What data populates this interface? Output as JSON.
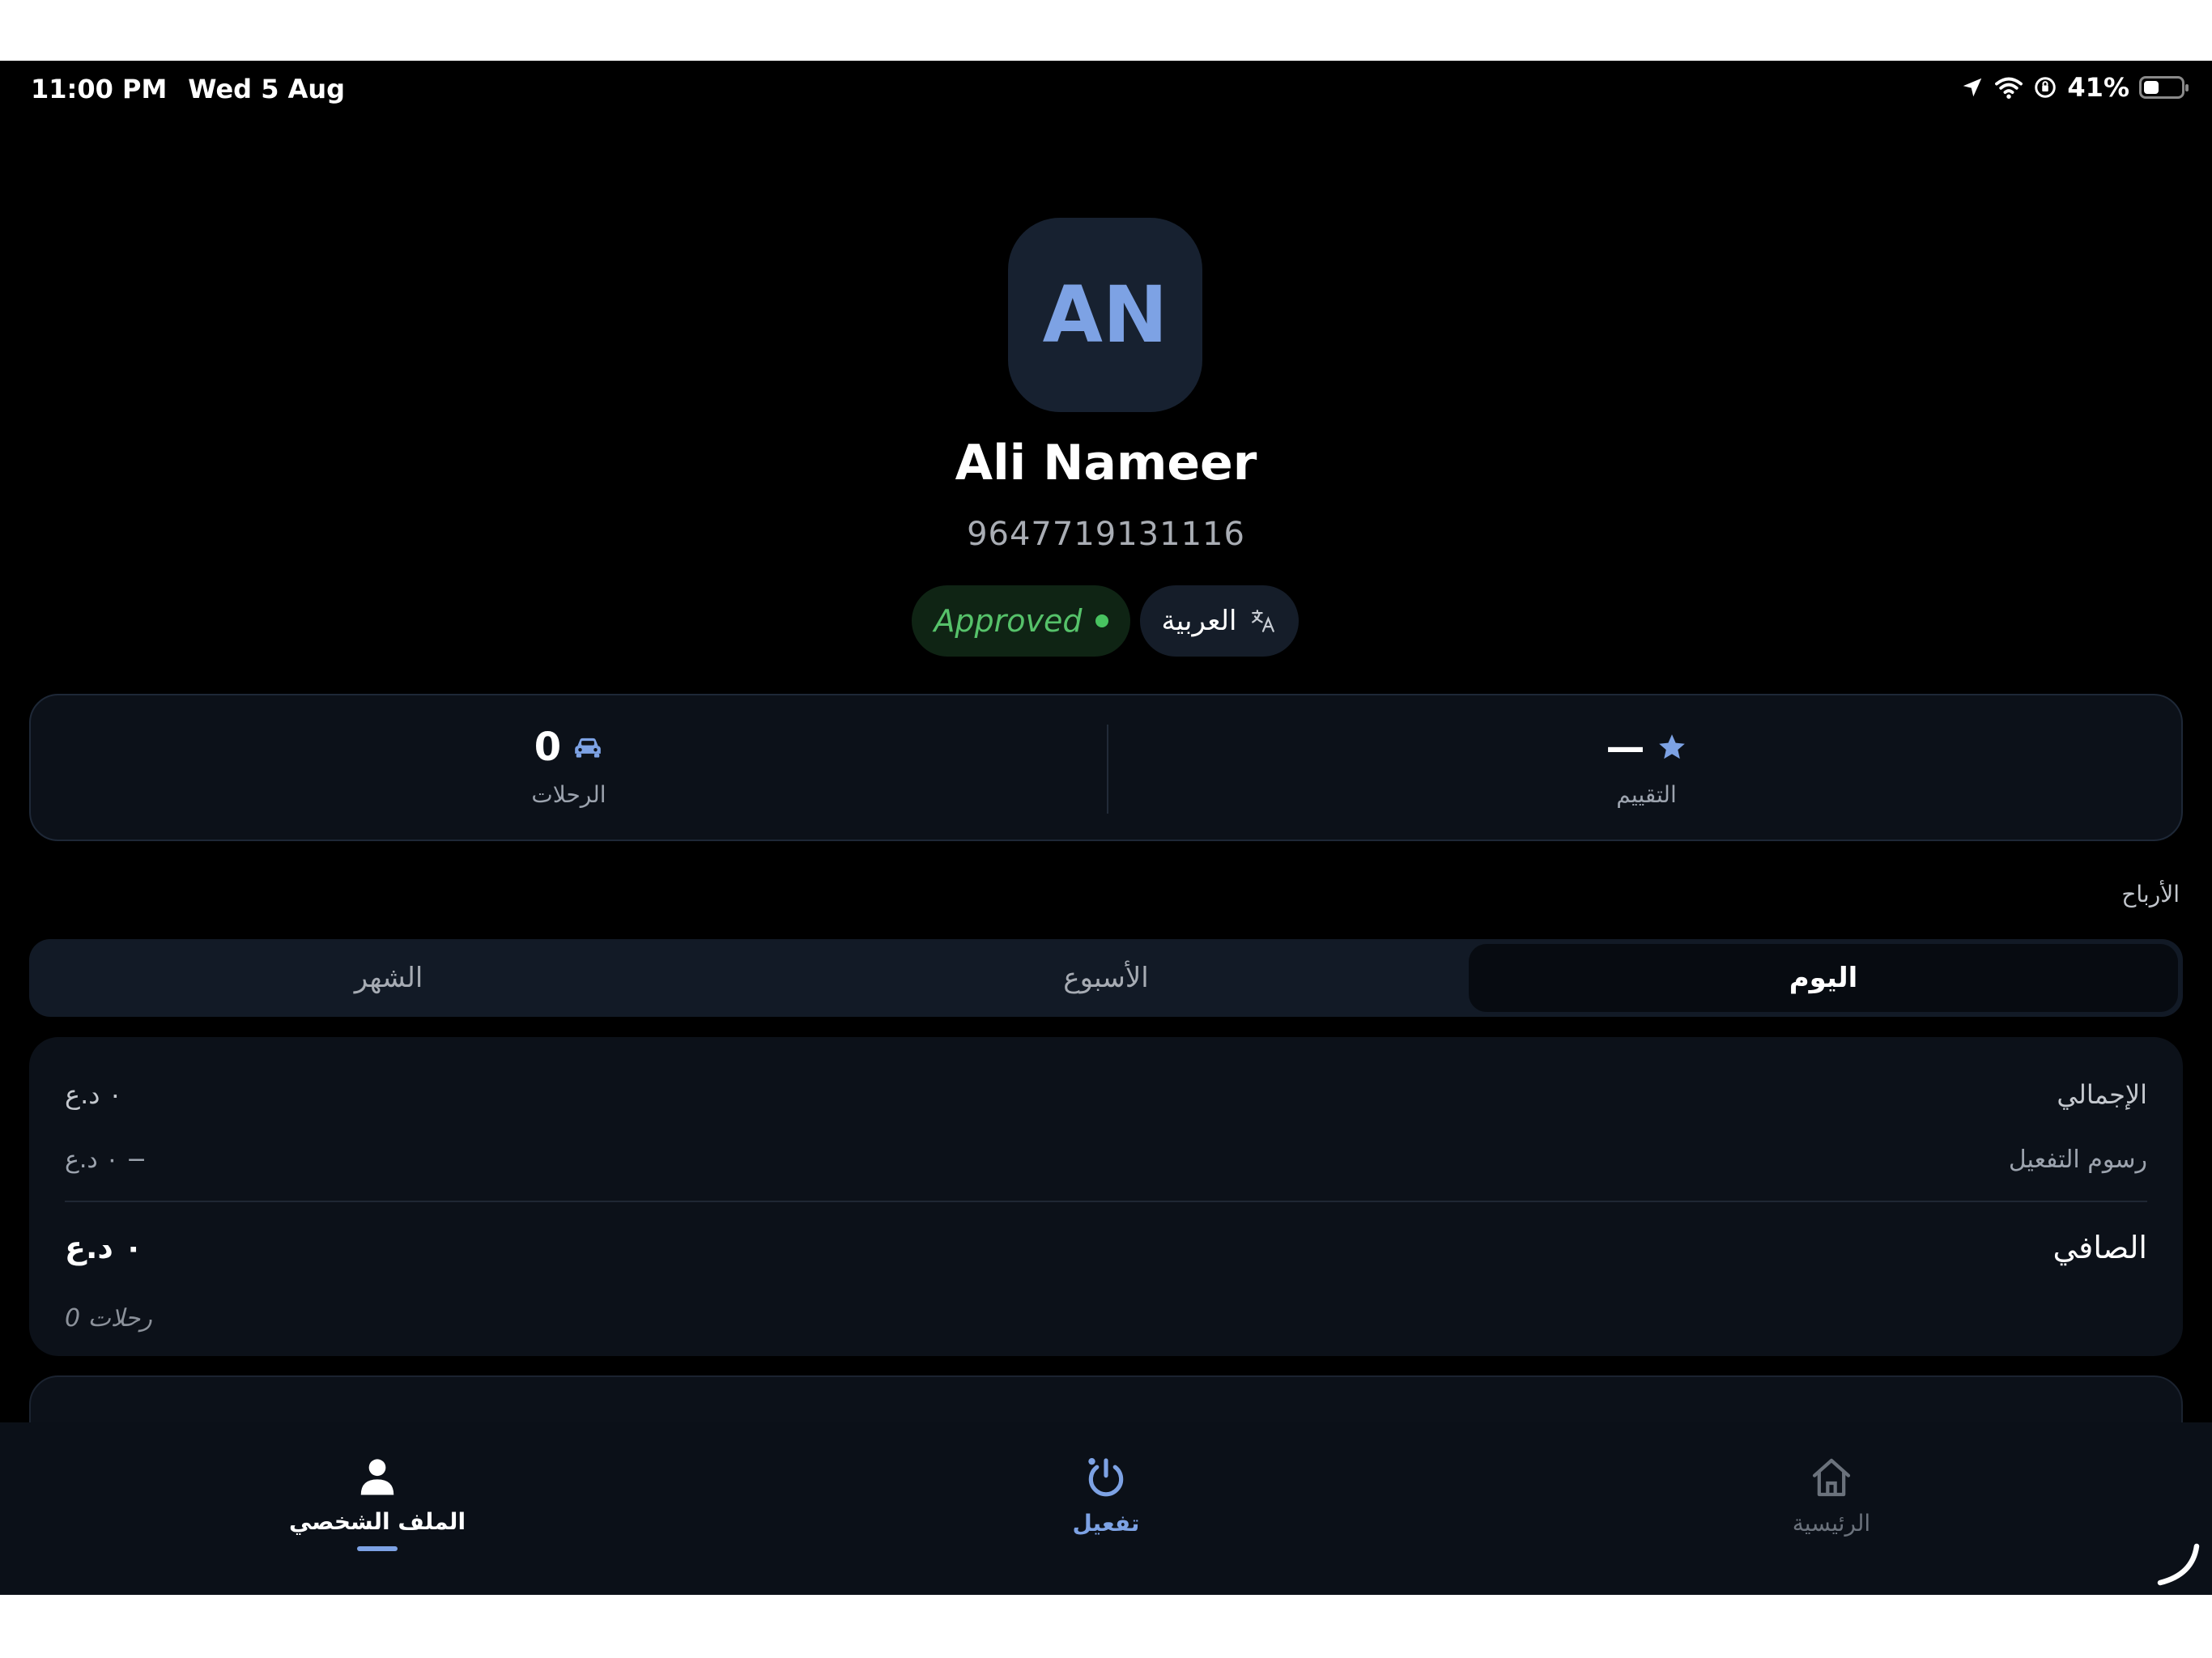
{
  "status_bar": {
    "time": "11:00 PM",
    "date": "Wed 5 Aug",
    "battery_text": "41%",
    "battery_level": 0.41,
    "icons": [
      "location-arrow-icon",
      "wifi-icon",
      "orientation-lock-icon",
      "battery-icon"
    ]
  },
  "profile": {
    "initials": "AN",
    "name": "Ali Nameer",
    "phone": "9647719131116",
    "status_label": "Approved",
    "language_label": "العربية"
  },
  "stats": {
    "trips_value": "0",
    "trips_label": "الرحلات",
    "rating_value": "—",
    "rating_label": "التقييم"
  },
  "earnings": {
    "section_title": "الأرباح",
    "tabs": [
      {
        "label": "اليوم",
        "active": true
      },
      {
        "label": "الأسبوع",
        "active": false
      },
      {
        "label": "الشهر",
        "active": false
      }
    ],
    "total_label": "الإجمالي",
    "total_value": "٠ د.ع",
    "fees_label": "رسوم التفعيل",
    "fees_value": "٠ د.ع −",
    "net_label": "الصافي",
    "net_value": "٠ د.ع",
    "trips_count_text": "0 رحلات"
  },
  "nav": {
    "items": [
      {
        "label": "الملف الشخصي",
        "icon": "user-icon",
        "active": true
      },
      {
        "label": "تفعيل",
        "icon": "power-icon",
        "active": false
      },
      {
        "label": "الرئيسية",
        "icon": "home-icon",
        "active": false
      }
    ]
  },
  "colors": {
    "accent": "#7da2e4",
    "approved_green": "#56c26a",
    "background": "#000000",
    "card": "#0c1119"
  }
}
